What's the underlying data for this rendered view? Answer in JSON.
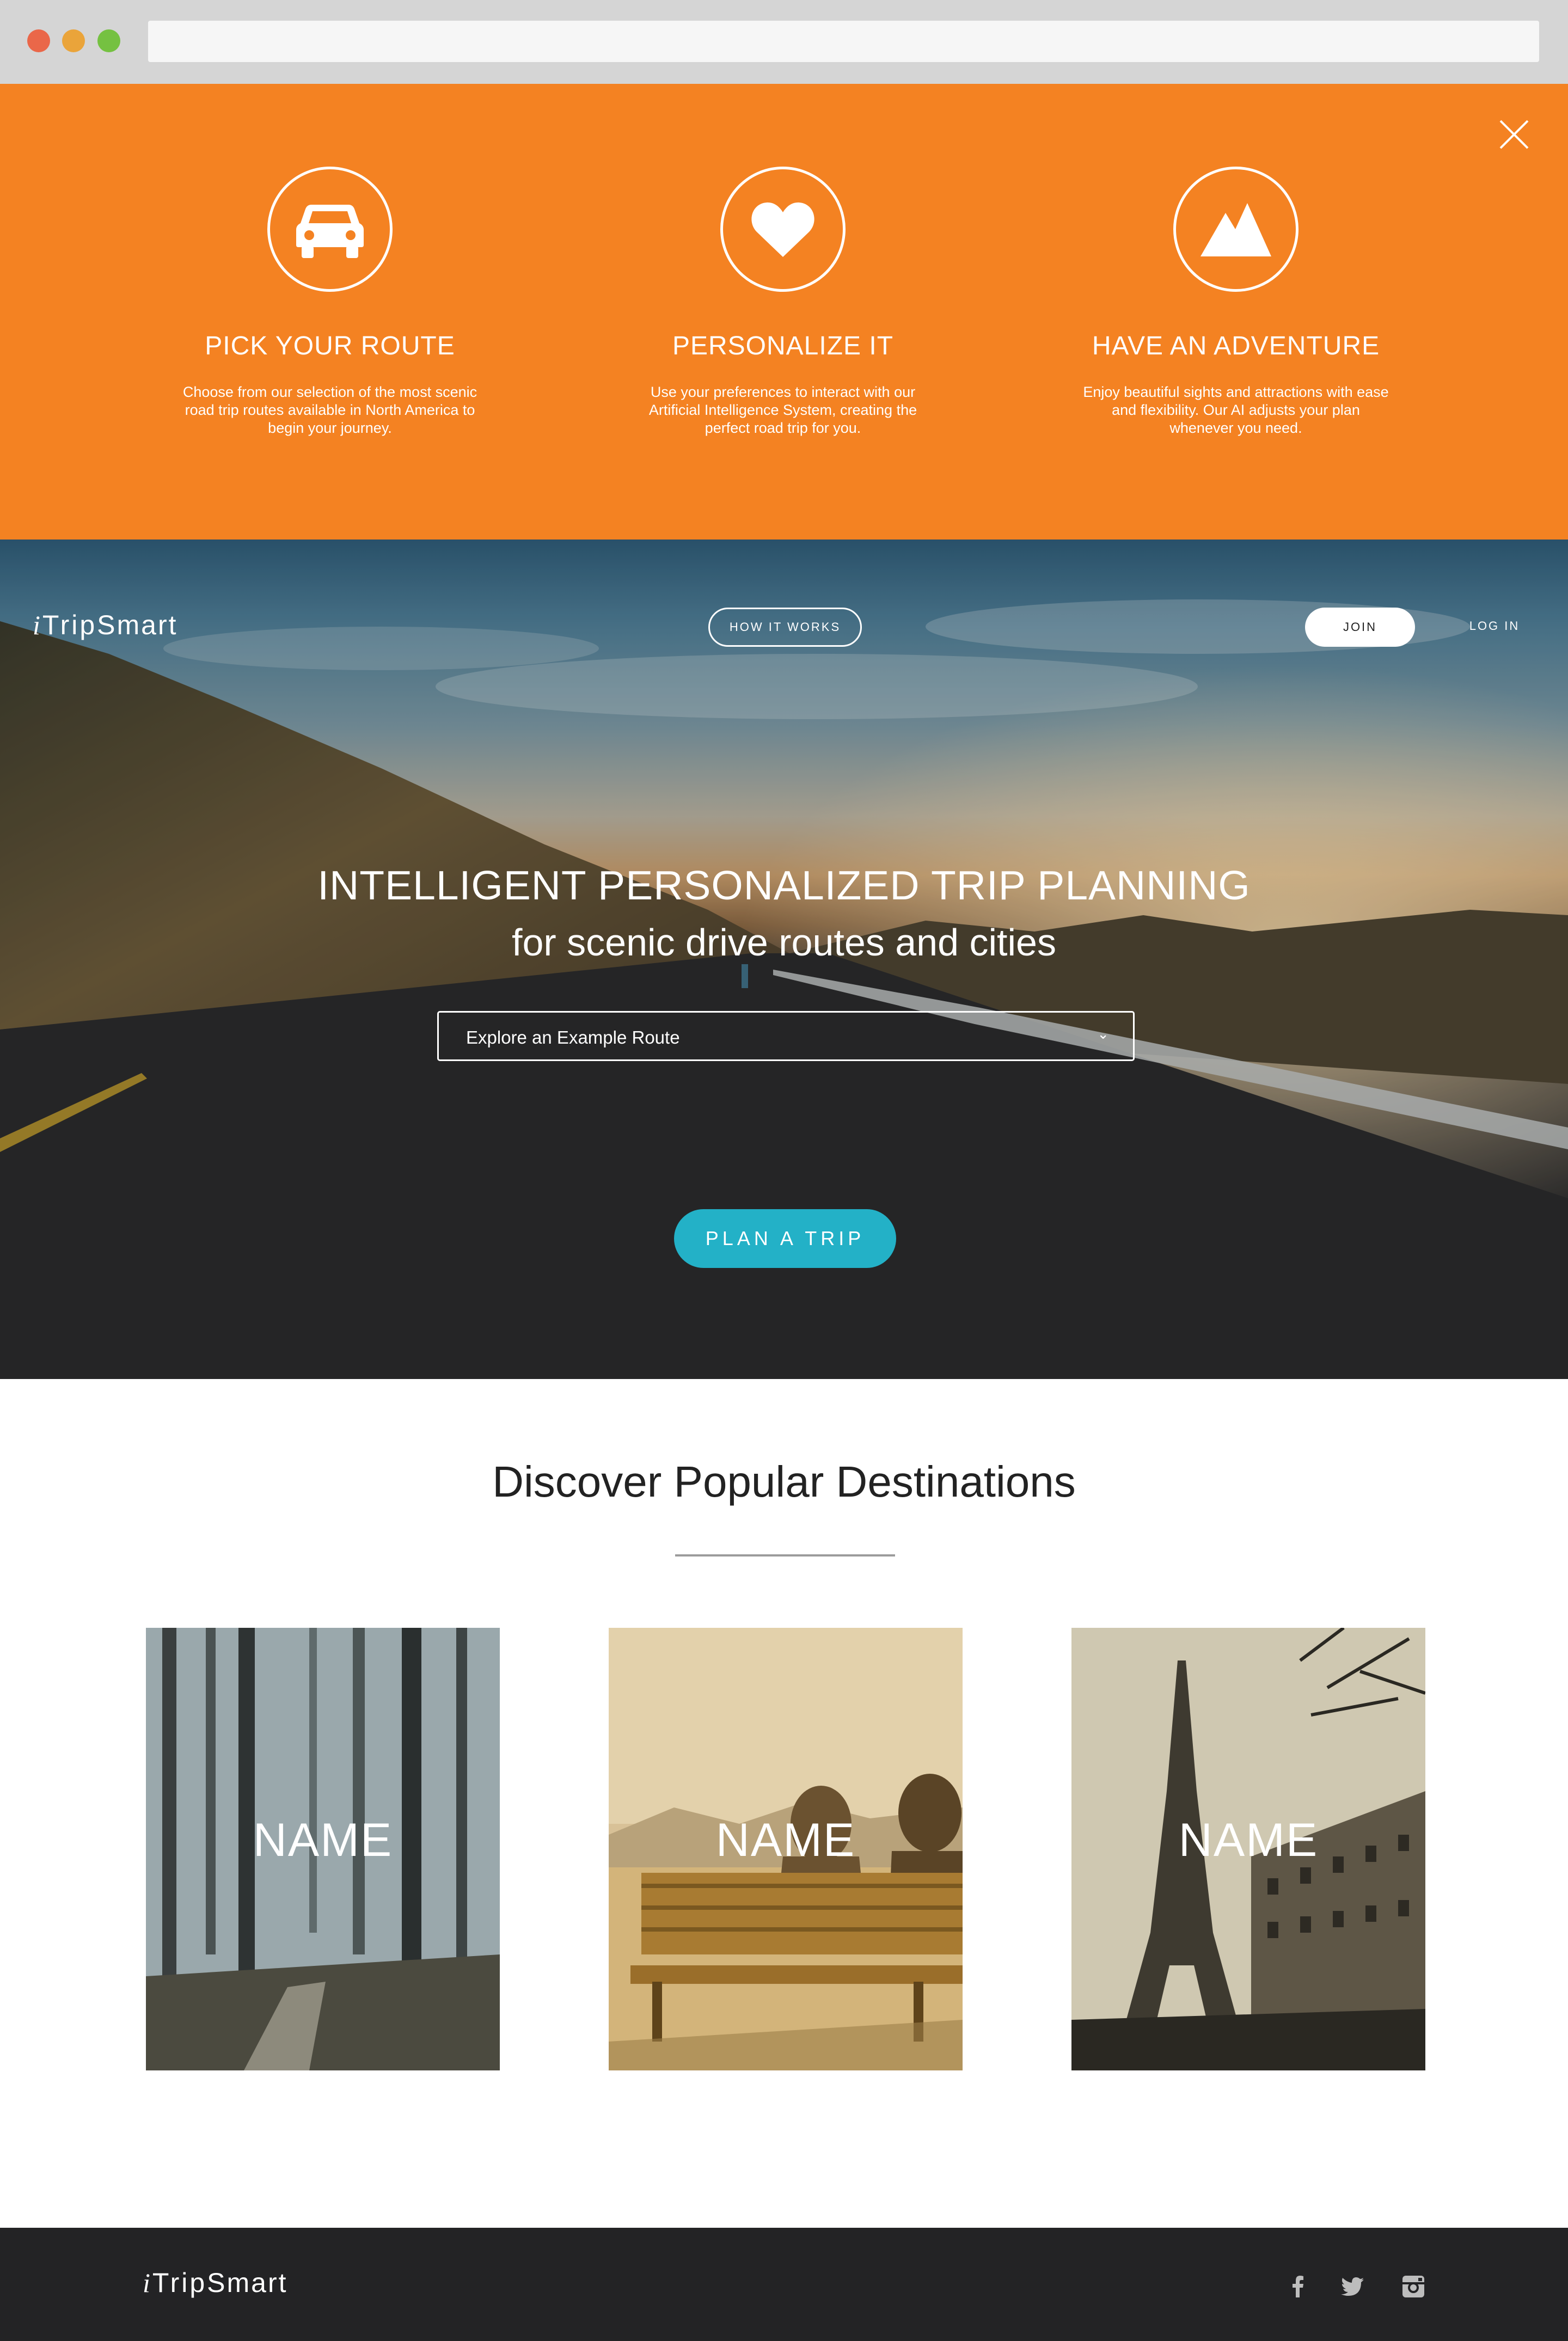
{
  "browser": {
    "address_value": ""
  },
  "how_it_works": {
    "close_icon": "close-x-icon",
    "features": [
      {
        "icon": "car-icon",
        "title": "PICK YOUR ROUTE",
        "description": "Choose from our selection of the most scenic road trip routes available in North America to begin your journey."
      },
      {
        "icon": "heart-icon",
        "title": "PERSONALIZE IT",
        "description": "Use your preferences to interact with our Artificial Intelligence System, creating the perfect road trip for you."
      },
      {
        "icon": "mountain-icon",
        "title": "HAVE AN ADVENTURE",
        "description": "Enjoy beautiful sights and attractions with ease and flexibility. Our AI adjusts your plan whenever you need."
      }
    ]
  },
  "header": {
    "logo_prefix": "i",
    "logo_trip": "Trip",
    "logo_smart": "Smart",
    "nav_how": "HOW IT WORKS",
    "nav_join": "JOIN",
    "nav_login": "LOG IN"
  },
  "hero": {
    "title": "INTELLIGENT PERSONALIZED TRIP PLANNING",
    "subtitle": "for scenic drive routes and cities",
    "select_placeholder": "Explore an Example Route",
    "select_caret": "⌄",
    "cta": "PLAN A TRIP"
  },
  "destinations": {
    "title": "Discover Popular Destinations",
    "cards": [
      {
        "name": "NAME",
        "image": "misty-forest-photo"
      },
      {
        "name": "NAME",
        "image": "couple-on-bench-photo"
      },
      {
        "name": "NAME",
        "image": "eiffel-tower-photo"
      }
    ]
  },
  "footer": {
    "logo_prefix": "i",
    "logo_trip": "Trip",
    "logo_smart": "Smart",
    "social": [
      "facebook-icon",
      "twitter-icon",
      "instagram-icon"
    ]
  },
  "colors": {
    "orange_panel": "#f48222",
    "cta_teal": "#23b1c7",
    "footer_bg": "#232325",
    "traffic_red": "#ea6749",
    "traffic_yellow": "#eaa43a",
    "traffic_green": "#75c141"
  }
}
